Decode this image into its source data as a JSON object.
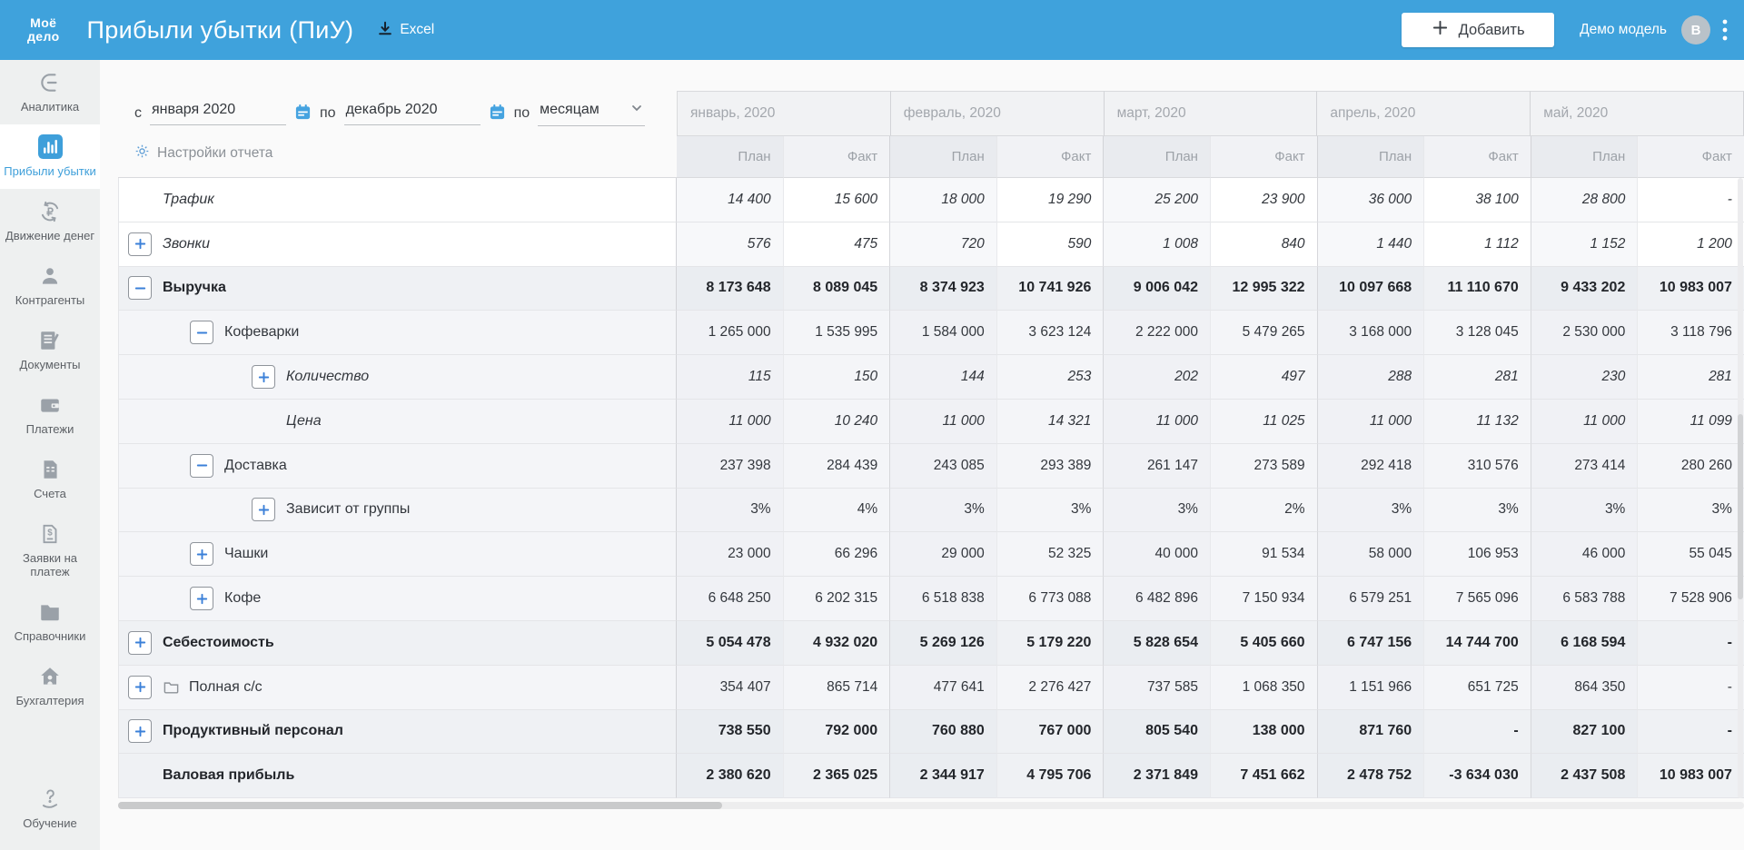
{
  "header": {
    "logo_line1": "Моё",
    "logo_line2": "дело",
    "title": "Прибыли убытки (ПиУ)",
    "excel_label": "Excel",
    "add_button_label": "Добавить",
    "model_name": "Демо модель",
    "avatar_initial": "В"
  },
  "sidebar": {
    "items": [
      {
        "id": "analytics",
        "label": "Аналитика",
        "icon": "analytics-icon",
        "active": false
      },
      {
        "id": "profit-loss",
        "label": "Прибыли убытки",
        "icon": "bar-chart-icon",
        "active": true
      },
      {
        "id": "money-flow",
        "label": "Движение денег",
        "icon": "money-flow-icon",
        "active": false
      },
      {
        "id": "counterparties",
        "label": "Контрагенты",
        "icon": "person-icon",
        "active": false
      },
      {
        "id": "documents",
        "label": "Документы",
        "icon": "document-pen-icon",
        "active": false
      },
      {
        "id": "payments",
        "label": "Платежи",
        "icon": "wallet-icon",
        "active": false
      },
      {
        "id": "invoices",
        "label": "Счета",
        "icon": "invoice-icon",
        "active": false
      },
      {
        "id": "payment-requests",
        "label": "Заявки на платеж",
        "icon": "payment-request-icon",
        "active": false
      },
      {
        "id": "directories",
        "label": "Справочники",
        "icon": "folder-filled-icon",
        "active": false
      },
      {
        "id": "accounting",
        "label": "Бухгалтерия",
        "icon": "house-icon",
        "active": false
      },
      {
        "id": "education",
        "label": "Обучение",
        "icon": "question-hand-icon",
        "active": false
      }
    ]
  },
  "filters": {
    "from_label": "с",
    "from_value": "января 2020",
    "to_label": "по",
    "to_value": "декабрь 2020",
    "period_label": "по",
    "period_value": "месяцам",
    "settings_label": "Настройки отчета"
  },
  "table": {
    "months": [
      "январь, 2020",
      "февраль, 2020",
      "март, 2020",
      "апрель, 2020",
      "май, 2020"
    ],
    "plan_label": "План",
    "fact_label": "Факт",
    "rows": [
      {
        "label": "Трафик",
        "level": 0,
        "toggle": null,
        "folder": false,
        "bold": false,
        "italic": true,
        "shade": "white",
        "values": [
          "14 400",
          "15 600",
          "18 000",
          "19 290",
          "25 200",
          "23 900",
          "36 000",
          "38 100",
          "28 800",
          "-"
        ]
      },
      {
        "label": "Звонки",
        "level": 0,
        "toggle": "plus",
        "folder": false,
        "bold": false,
        "italic": true,
        "shade": "white",
        "values": [
          "576",
          "475",
          "720",
          "590",
          "1 008",
          "840",
          "1 440",
          "1 112",
          "1 152",
          "1 200"
        ]
      },
      {
        "label": "Выручка",
        "level": 0,
        "toggle": "minus",
        "folder": false,
        "bold": true,
        "italic": false,
        "shade": "group",
        "values": [
          "8 173 648",
          "8 089 045",
          "8 374 923",
          "10 741 926",
          "9 006 042",
          "12 995 322",
          "10 097 668",
          "11 110 670",
          "9 433 202",
          "10 983 007"
        ]
      },
      {
        "label": "Кофеварки",
        "level": 1,
        "toggle": "minus",
        "folder": false,
        "bold": false,
        "italic": false,
        "shade": "child",
        "values": [
          "1 265 000",
          "1 535 995",
          "1 584 000",
          "3 623 124",
          "2 222 000",
          "5 479 265",
          "3 168 000",
          "3 128 045",
          "2 530 000",
          "3 118 796"
        ]
      },
      {
        "label": "Количество",
        "level": 2,
        "toggle": "plus",
        "folder": false,
        "bold": false,
        "italic": true,
        "shade": "child",
        "values": [
          "115",
          "150",
          "144",
          "253",
          "202",
          "497",
          "288",
          "281",
          "230",
          "281"
        ]
      },
      {
        "label": "Цена",
        "level": 2,
        "toggle": null,
        "folder": false,
        "bold": false,
        "italic": true,
        "shade": "child",
        "values": [
          "11 000",
          "10 240",
          "11 000",
          "14 321",
          "11 000",
          "11 025",
          "11 000",
          "11 132",
          "11 000",
          "11 099"
        ]
      },
      {
        "label": "Доставка",
        "level": 1,
        "toggle": "minus",
        "folder": false,
        "bold": false,
        "italic": false,
        "shade": "child",
        "values": [
          "237 398",
          "284 439",
          "243 085",
          "293 389",
          "261 147",
          "273 589",
          "292 418",
          "310 576",
          "273 414",
          "280 260"
        ]
      },
      {
        "label": "Зависит от группы",
        "level": 2,
        "toggle": "plus",
        "folder": false,
        "bold": false,
        "italic": false,
        "shade": "child",
        "values": [
          "3%",
          "4%",
          "3%",
          "3%",
          "3%",
          "2%",
          "3%",
          "3%",
          "3%",
          "3%"
        ]
      },
      {
        "label": "Чашки",
        "level": 1,
        "toggle": "plus",
        "folder": false,
        "bold": false,
        "italic": false,
        "shade": "child",
        "values": [
          "23 000",
          "66 296",
          "29 000",
          "52 325",
          "40 000",
          "91 534",
          "58 000",
          "106 953",
          "46 000",
          "55 045"
        ]
      },
      {
        "label": "Кофе",
        "level": 1,
        "toggle": "plus",
        "folder": false,
        "bold": false,
        "italic": false,
        "shade": "child",
        "values": [
          "6 648 250",
          "6 202 315",
          "6 518 838",
          "6 773 088",
          "6 482 896",
          "7 150 934",
          "6 579 251",
          "7 565 096",
          "6 583 788",
          "7 528 906"
        ]
      },
      {
        "label": "Себестоимость",
        "level": 0,
        "toggle": "plus",
        "folder": false,
        "bold": true,
        "italic": false,
        "shade": "group",
        "values": [
          "5 054 478",
          "4 932 020",
          "5 269 126",
          "5 179 220",
          "5 828 654",
          "5 405 660",
          "6 747 156",
          "14 744 700",
          "6 168 594",
          "-"
        ]
      },
      {
        "label": "Полная с/с",
        "level": 0,
        "toggle": "plus",
        "folder": true,
        "bold": false,
        "italic": false,
        "shade": "child",
        "values": [
          "354 407",
          "865 714",
          "477 641",
          "2 276 427",
          "737 585",
          "1 068 350",
          "1 151 966",
          "651 725",
          "864 350",
          "-"
        ]
      },
      {
        "label": "Продуктивный персонал",
        "level": 0,
        "toggle": "plus",
        "folder": false,
        "bold": true,
        "italic": false,
        "shade": "group",
        "values": [
          "738 550",
          "792 000",
          "760 880",
          "767 000",
          "805 540",
          "138 000",
          "871 760",
          "-",
          "827 100",
          "-"
        ]
      },
      {
        "label": "Валовая прибыль",
        "level": 0,
        "toggle": null,
        "folder": false,
        "bold": true,
        "italic": false,
        "shade": "group",
        "values": [
          "2 380 620",
          "2 365 025",
          "2 344 917",
          "4 795 706",
          "2 371 849",
          "7 451 662",
          "2 478 752",
          "-3 634 030",
          "2 437 508",
          "10 983 007"
        ]
      }
    ]
  },
  "colors": {
    "header_bg": "#3fa2dc",
    "accent_blue": "#3e9fda",
    "toggle_glyph": "#3b80d8"
  }
}
